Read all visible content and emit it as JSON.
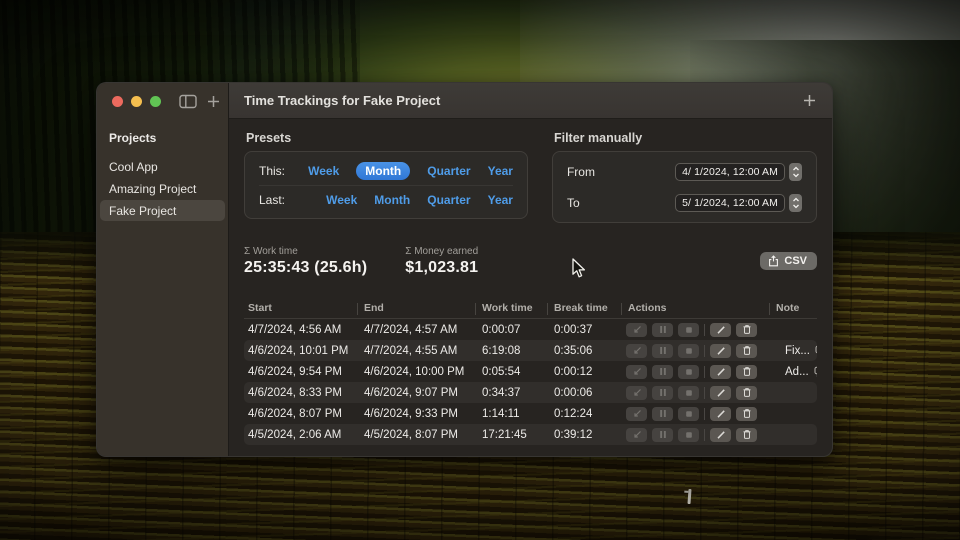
{
  "window": {
    "title": "Time Trackings for Fake Project",
    "icons": {
      "traffic_lights": [
        "close-red",
        "minimize-yellow",
        "zoom-green"
      ],
      "toolbar": [
        "sidebar-toggle-icon",
        "plus-icon"
      ],
      "titlebar_right": "plus-icon",
      "csv": "export-icon",
      "row_actions": [
        "resume-icon",
        "pause-icon",
        "stop-icon",
        "edit-pencil-icon",
        "trash-icon"
      ],
      "note": "comment-bubble-icon",
      "date_field": "stepper-up-down-icon"
    },
    "colors": {
      "accent_blue": "#4f9ce8",
      "selected_pill": "#3b82dd",
      "close": "#ec6a5e",
      "minimize": "#f5bf4f",
      "zoom": "#61c454"
    },
    "sidebar": {
      "header": "Projects",
      "items": [
        {
          "label": "Cool App",
          "selected": false
        },
        {
          "label": "Amazing Project",
          "selected": false
        },
        {
          "label": "Fake Project",
          "selected": true
        }
      ]
    },
    "presets": {
      "header": "Presets",
      "selected_option": "This: Month",
      "rows": [
        {
          "label": "This:",
          "options": [
            {
              "label": "Week"
            },
            {
              "label": "Month"
            },
            {
              "label": "Quarter"
            },
            {
              "label": "Year"
            }
          ]
        },
        {
          "label": "Last:",
          "options": [
            {
              "label": "Week"
            },
            {
              "label": "Month"
            },
            {
              "label": "Quarter"
            },
            {
              "label": "Year"
            }
          ]
        }
      ]
    },
    "filter": {
      "header": "Filter manually",
      "from_label": "From",
      "from_value": "4/ 1/2024, 12:00 AM",
      "to_label": "To",
      "to_value": "5/ 1/2024, 12:00 AM"
    },
    "summary": {
      "work_time_label": "Σ Work time",
      "work_time_value": "25:35:43 (25.6h)",
      "money_label": "Σ Money earned",
      "money_value": "$1,023.81",
      "csv_button": "CSV"
    },
    "table": {
      "columns": [
        "Start",
        "End",
        "Work time",
        "Break time",
        "Actions",
        "Note"
      ],
      "rows": [
        {
          "start": "4/7/2024, 4:56 AM",
          "end": "4/7/2024, 4:57 AM",
          "work": "0:00:07",
          "break": "0:00:37",
          "note": ""
        },
        {
          "start": "4/6/2024, 10:01 PM",
          "end": "4/7/2024, 4:55 AM",
          "work": "6:19:08",
          "break": "0:35:06",
          "note": "Fix..."
        },
        {
          "start": "4/6/2024, 9:54 PM",
          "end": "4/6/2024, 10:00 PM",
          "work": "0:05:54",
          "break": "0:00:12",
          "note": "Ad..."
        },
        {
          "start": "4/6/2024, 8:33 PM",
          "end": "4/6/2024, 9:07 PM",
          "work": "0:34:37",
          "break": "0:00:06",
          "note": ""
        },
        {
          "start": "4/6/2024, 8:07 PM",
          "end": "4/6/2024, 9:33 PM",
          "work": "1:14:11",
          "break": "0:12:24",
          "note": ""
        },
        {
          "start": "4/5/2024, 2:06 AM",
          "end": "4/5/2024, 8:07 PM",
          "work": "17:21:45",
          "break": "0:39:12",
          "note": ""
        }
      ]
    }
  }
}
